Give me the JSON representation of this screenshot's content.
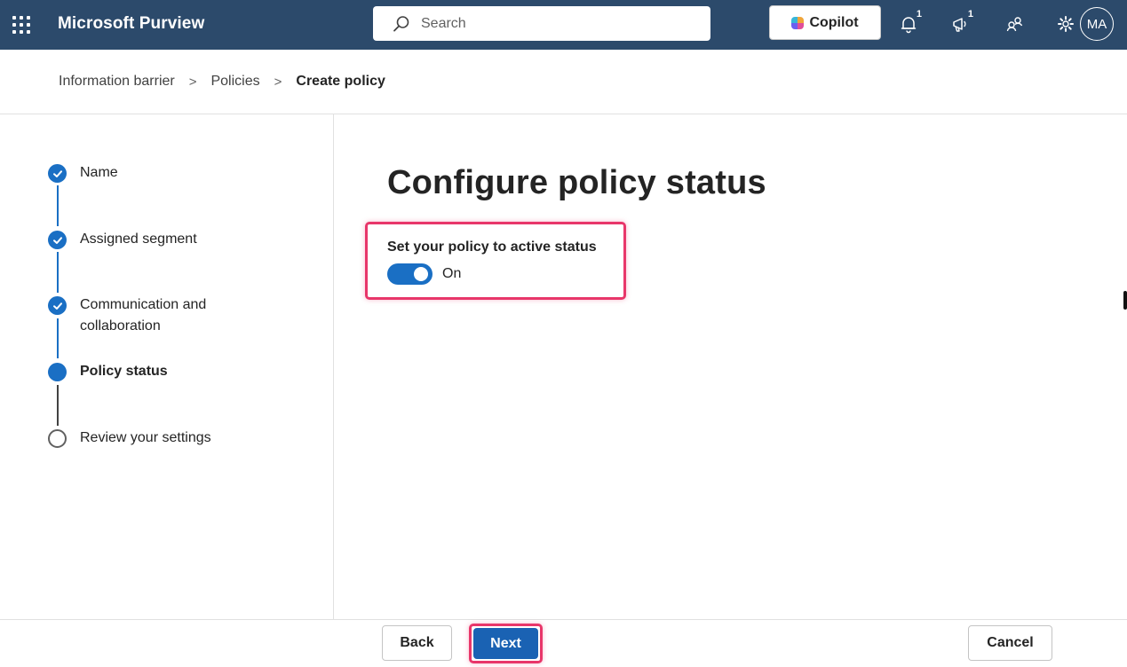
{
  "header": {
    "app_title": "Microsoft Purview",
    "search_placeholder": "Search",
    "copilot_label": "Copilot",
    "notifications_badge": "1",
    "announcements_badge": "1",
    "avatar_initials": "MA",
    "bar_color": "#2c4a6b"
  },
  "breadcrumb": {
    "items": [
      "Information barrier",
      "Policies"
    ],
    "current": "Create policy",
    "separator": ">"
  },
  "stepper": {
    "steps": [
      {
        "label": "Name",
        "state": "completed"
      },
      {
        "label": "Assigned segment",
        "state": "completed"
      },
      {
        "label": "Communication and collaboration",
        "state": "completed"
      },
      {
        "label": "Policy status",
        "state": "current"
      },
      {
        "label": "Review your settings",
        "state": "not-started"
      }
    ]
  },
  "main": {
    "title": "Configure policy status",
    "toggle_label": "Set your policy to active status",
    "toggle_state": "On",
    "toggle_on": true
  },
  "footer": {
    "back_label": "Back",
    "next_label": "Next",
    "cancel_label": "Cancel"
  },
  "colors": {
    "accent": "#1a6fc4",
    "highlight": "#e8366a"
  }
}
